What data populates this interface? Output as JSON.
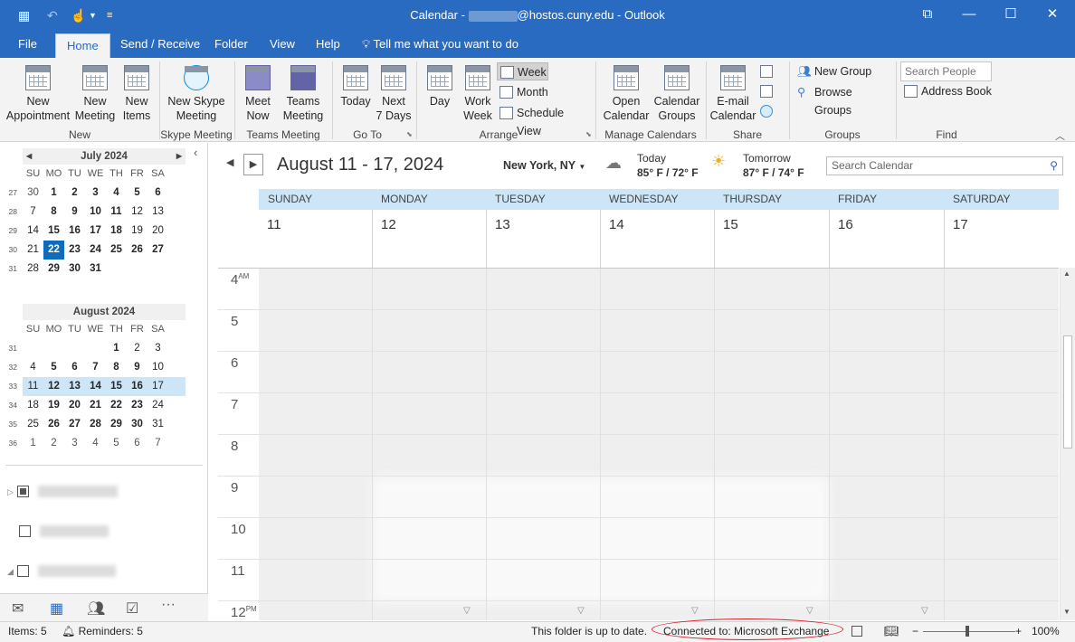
{
  "window": {
    "title_prefix": "Calendar - ",
    "title_suffix": "@hostos.cuny.edu  -  Outlook"
  },
  "menu": {
    "tabs": [
      "File",
      "Home",
      "Send / Receive",
      "Folder",
      "View",
      "Help"
    ],
    "tell_me": "Tell me what you want to do"
  },
  "ribbon": {
    "new_appointment": "New\nAppointment",
    "new_meeting": "New\nMeeting",
    "new_items": "New\nItems",
    "group_new": "New",
    "new_skype_meeting": "New Skype\nMeeting",
    "group_skype": "Skype Meeting",
    "meet_now": "Meet\nNow",
    "teams_meeting": "Teams\nMeeting",
    "group_teams": "Teams Meeting",
    "today": "Today",
    "next7": "Next\n7 Days",
    "group_goto": "Go To",
    "day": "Day",
    "work_week": "Work\nWeek",
    "week": "Week",
    "month": "Month",
    "schedule_view": "Schedule View",
    "group_arrange": "Arrange",
    "open_calendar": "Open\nCalendar",
    "calendar_groups": "Calendar\nGroups",
    "group_manage": "Manage Calendars",
    "email_calendar": "E-mail\nCalendar",
    "group_share": "Share",
    "new_group": "New Group",
    "browse_groups": "Browse Groups",
    "group_groups": "Groups",
    "search_people_placeholder": "Search People",
    "address_book": "Address Book",
    "group_find": "Find"
  },
  "minical_july": {
    "title": "July 2024",
    "dow": [
      "SU",
      "MO",
      "TU",
      "WE",
      "TH",
      "FR",
      "SA"
    ],
    "weeks": [
      {
        "wk": "27",
        "days": [
          "30",
          "1",
          "2",
          "3",
          "4",
          "5",
          "6"
        ]
      },
      {
        "wk": "28",
        "days": [
          "7",
          "8",
          "9",
          "10",
          "11",
          "12",
          "13"
        ]
      },
      {
        "wk": "29",
        "days": [
          "14",
          "15",
          "16",
          "17",
          "18",
          "19",
          "20"
        ]
      },
      {
        "wk": "30",
        "days": [
          "21",
          "22",
          "23",
          "24",
          "25",
          "26",
          "27"
        ]
      },
      {
        "wk": "31",
        "days": [
          "28",
          "29",
          "30",
          "31",
          "",
          "",
          ""
        ]
      }
    ]
  },
  "minical_aug": {
    "title": "August 2024",
    "dow": [
      "SU",
      "MO",
      "TU",
      "WE",
      "TH",
      "FR",
      "SA"
    ],
    "weeks": [
      {
        "wk": "31",
        "days": [
          "",
          "",
          "",
          "",
          "1",
          "2",
          "3"
        ]
      },
      {
        "wk": "32",
        "days": [
          "4",
          "5",
          "6",
          "7",
          "8",
          "9",
          "10"
        ]
      },
      {
        "wk": "33",
        "days": [
          "11",
          "12",
          "13",
          "14",
          "15",
          "16",
          "17"
        ]
      },
      {
        "wk": "34",
        "days": [
          "18",
          "19",
          "20",
          "21",
          "22",
          "23",
          "24"
        ]
      },
      {
        "wk": "35",
        "days": [
          "25",
          "26",
          "27",
          "28",
          "29",
          "30",
          "31"
        ]
      },
      {
        "wk": "36",
        "days": [
          "1",
          "2",
          "3",
          "4",
          "5",
          "6",
          "7"
        ]
      }
    ]
  },
  "folders": [
    "My Calendars",
    "Other Calendars",
    "Shared Calendars"
  ],
  "main": {
    "date_range": "August 11 - 17, 2024",
    "location": "New York, NY",
    "weather_today_label": "Today",
    "weather_today_temp": "85° F / 72° F",
    "weather_tomorrow_label": "Tomorrow",
    "weather_tomorrow_temp": "87° F / 74° F",
    "search_placeholder": "Search Calendar",
    "days": [
      {
        "name": "SUNDAY",
        "num": "11"
      },
      {
        "name": "MONDAY",
        "num": "12"
      },
      {
        "name": "TUESDAY",
        "num": "13"
      },
      {
        "name": "WEDNESDAY",
        "num": "14"
      },
      {
        "name": "THURSDAY",
        "num": "15"
      },
      {
        "name": "FRIDAY",
        "num": "16"
      },
      {
        "name": "SATURDAY",
        "num": "17"
      }
    ],
    "hours": [
      {
        "h": "4",
        "ap": "AM"
      },
      {
        "h": "5",
        "ap": ""
      },
      {
        "h": "6",
        "ap": ""
      },
      {
        "h": "7",
        "ap": ""
      },
      {
        "h": "8",
        "ap": ""
      },
      {
        "h": "9",
        "ap": ""
      },
      {
        "h": "10",
        "ap": ""
      },
      {
        "h": "11",
        "ap": ""
      },
      {
        "h": "12",
        "ap": "PM"
      }
    ]
  },
  "status": {
    "items": "Items: 5",
    "reminders": "Reminders: 5",
    "folder_status": "This folder is up to date.",
    "connection": "Connected to: Microsoft Exchange",
    "zoom": "100%"
  }
}
